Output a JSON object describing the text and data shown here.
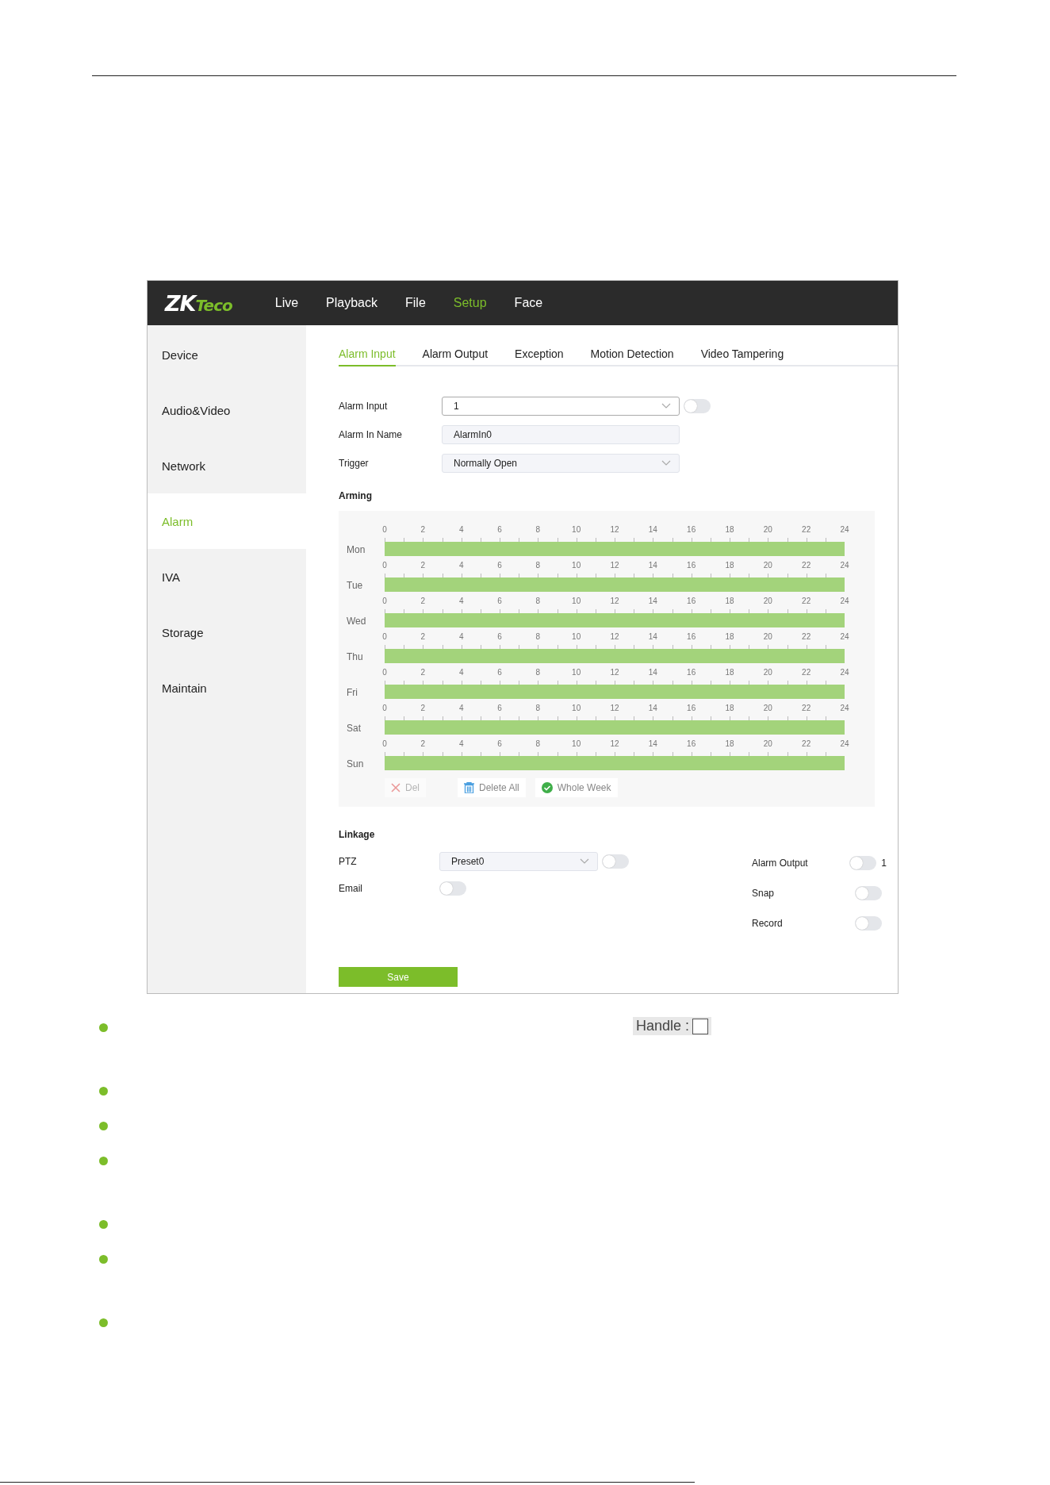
{
  "app": {
    "logo": {
      "lead": "ZK",
      "tail": "Teco"
    },
    "nav": [
      {
        "label": "Live",
        "selected": false
      },
      {
        "label": "Playback",
        "selected": false
      },
      {
        "label": "File",
        "selected": false
      },
      {
        "label": "Setup",
        "selected": true
      },
      {
        "label": "Face",
        "selected": false
      }
    ],
    "sidebar": {
      "items": [
        {
          "label": "Device",
          "selected": false
        },
        {
          "label": "Audio&Video",
          "selected": false
        },
        {
          "label": "Network",
          "selected": false
        },
        {
          "label": "Alarm",
          "selected": true
        },
        {
          "label": "IVA",
          "selected": false
        },
        {
          "label": "Storage",
          "selected": false
        },
        {
          "label": "Maintain",
          "selected": false
        }
      ]
    },
    "tabs": [
      {
        "label": "Alarm Input",
        "selected": true
      },
      {
        "label": "Alarm Output",
        "selected": false
      },
      {
        "label": "Exception",
        "selected": false
      },
      {
        "label": "Motion Detection",
        "selected": false
      },
      {
        "label": "Video Tampering",
        "selected": false
      }
    ],
    "form": [
      {
        "kind": "select",
        "label": "Alarm Input",
        "value": "1",
        "toggle": {
          "on": false
        }
      },
      {
        "kind": "text",
        "label": "Alarm In Name",
        "value": "AlarmIn0"
      },
      {
        "kind": "select",
        "label": "Trigger",
        "value": "Normally Open"
      }
    ],
    "arming": {
      "title": "Arming",
      "days": [
        {
          "name": "Mon",
          "ticks": [
            "0",
            "2",
            "4",
            "6",
            "8",
            "10",
            "12",
            "14",
            "16",
            "18",
            "20",
            "22",
            "24"
          ],
          "level": 1
        },
        {
          "name": "Tue",
          "ticks": [
            "0",
            "2",
            "4",
            "6",
            "8",
            "10",
            "12",
            "14",
            "16",
            "18",
            "20",
            "22",
            "24"
          ],
          "level": 1
        },
        {
          "name": "Wed",
          "ticks": [
            "0",
            "2",
            "4",
            "6",
            "8",
            "10",
            "12",
            "14",
            "16",
            "18",
            "20",
            "22",
            "24"
          ],
          "level": 1
        },
        {
          "name": "Thu",
          "ticks": [
            "0",
            "2",
            "4",
            "6",
            "8",
            "10",
            "12",
            "14",
            "16",
            "18",
            "20",
            "22",
            "24"
          ],
          "level": 1
        },
        {
          "name": "Fri",
          "ticks": [
            "0",
            "2",
            "4",
            "6",
            "8",
            "10",
            "12",
            "14",
            "16",
            "18",
            "20",
            "22",
            "24"
          ],
          "level": 1
        },
        {
          "name": "Sat",
          "ticks": [
            "0",
            "2",
            "4",
            "6",
            "8",
            "10",
            "12",
            "14",
            "16",
            "18",
            "20",
            "22",
            "24"
          ],
          "level": 1
        },
        {
          "name": "Sun",
          "ticks": [
            "0",
            "2",
            "4",
            "6",
            "8",
            "10",
            "12",
            "14",
            "16",
            "18",
            "20",
            "22",
            "24"
          ],
          "level": 1
        }
      ],
      "actions": [
        {
          "kind": "delete",
          "label": "Del",
          "disabled": true
        },
        {
          "kind": "delete-all",
          "label": "Delete All",
          "disabled": false
        },
        {
          "kind": "whole-week",
          "label": "Whole Week",
          "disabled": false
        }
      ]
    },
    "linkage": {
      "title": "Linkage",
      "left": [
        {
          "kind": "select",
          "label": "PTZ",
          "value": "Preset0",
          "toggle": {
            "on": false
          }
        },
        {
          "kind": "toggle",
          "label": "Email",
          "toggle": {
            "on": false
          }
        }
      ],
      "right": [
        {
          "label": "Alarm Output",
          "toggle": {
            "on": false
          },
          "suffix": "1"
        },
        {
          "label": "Snap",
          "toggle": {
            "on": false
          }
        },
        {
          "label": "Record",
          "toggle": {
            "on": false
          }
        }
      ]
    },
    "save": "Save"
  },
  "bullets": [
    {
      "kind": "two-line",
      "handle": {
        "label": "Handle :",
        "checked": false
      }
    },
    {
      "kind": "one-line"
    },
    {
      "kind": "one-line"
    },
    {
      "kind": "two-line"
    },
    {
      "kind": "one-line"
    },
    {
      "kind": "two-line"
    },
    {
      "kind": "one-line"
    }
  ]
}
